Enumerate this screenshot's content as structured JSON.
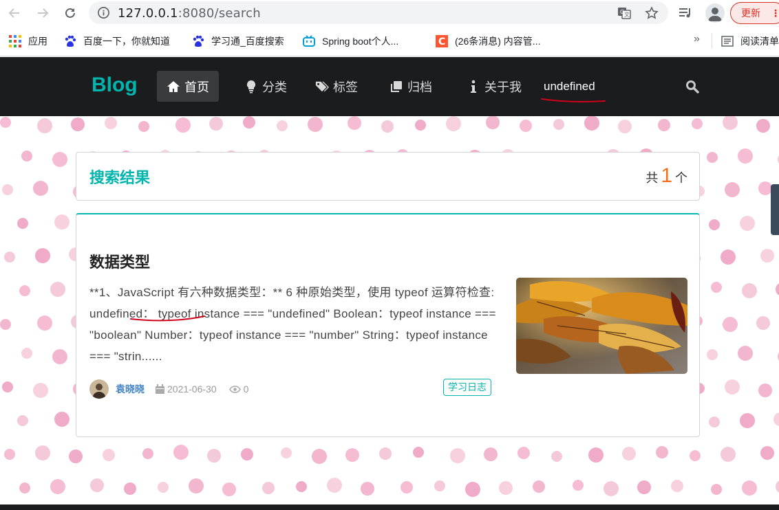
{
  "browser": {
    "url_host": "127.0.0.1",
    "url_path": ":8080/search",
    "update_label": "更新",
    "update_menu": "⋮",
    "bookmarks": [
      {
        "label": "应用",
        "icon": "apps-grid-icon"
      },
      {
        "label": "百度一下，你就知道",
        "icon": "baidu-paw-icon"
      },
      {
        "label": "学习通_百度搜索",
        "icon": "baidu-paw-icon"
      },
      {
        "label": "Spring boot个人...",
        "icon": "bilibili-tv-icon"
      },
      {
        "label": "(26条消息) 内容管...",
        "icon": "csdn-c-icon"
      }
    ],
    "bookmarks_more": "»",
    "reading_list": "阅读清单"
  },
  "site": {
    "logo": "Blog",
    "nav": [
      {
        "label": "首页",
        "icon": "home-icon",
        "active": true
      },
      {
        "label": "分类",
        "icon": "lightbulb-icon",
        "active": false
      },
      {
        "label": "标签",
        "icon": "tags-icon",
        "active": false
      },
      {
        "label": "归档",
        "icon": "clone-icon",
        "active": false
      },
      {
        "label": "关于我",
        "icon": "info-icon",
        "active": false
      }
    ],
    "username": "undefined"
  },
  "search": {
    "title": "搜索结果",
    "count_prefix": "共",
    "count": "1",
    "count_suffix": "个"
  },
  "article": {
    "title": "数据类型",
    "excerpt_before": "**1、JavaScript 有六种数据类型：** 6 种原始类型，使用 typeof 运算符检查: ",
    "excerpt_highlight": "undefined：",
    "excerpt_after": " typeof instance === \"undefined\" Boolean：typeof instance === \"boolean\" Number：typeof instance === \"number\" String：typeof instance === \"strin......",
    "author": "袁晓晓",
    "date": "2021-06-30",
    "views": "0",
    "tag": "学习日志"
  },
  "colors": {
    "accent": "#00b5ad",
    "count_orange": "#f2711c",
    "nav_bg": "#1b1c1d",
    "annotation_red": "#d0021b"
  }
}
